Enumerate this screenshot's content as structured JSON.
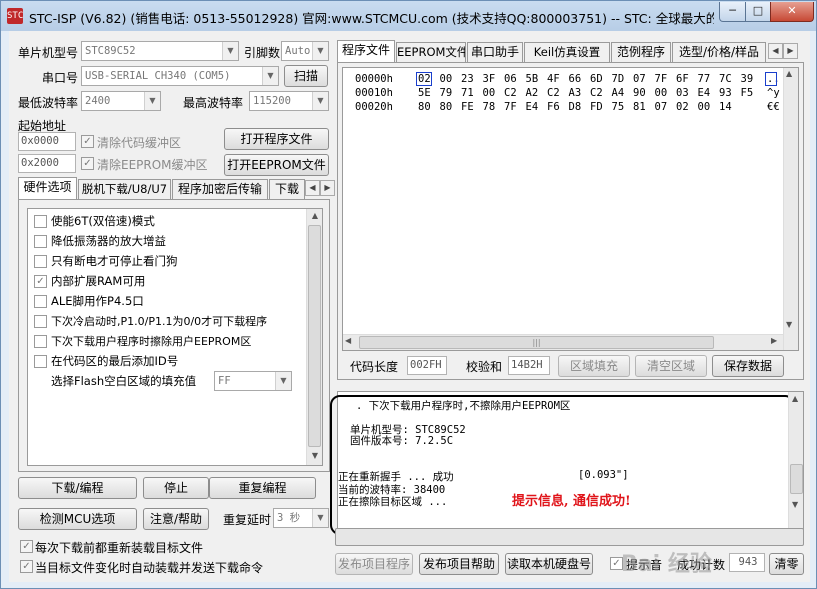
{
  "window": {
    "title": "STC-ISP (V6.82) (销售电话: 0513-55012928) 官网:www.STCMCU.com (技术支持QQ:800003751) -- STC: 全球最大的8051",
    "icon": "STC",
    "min": "─",
    "max": "□",
    "close": "✕"
  },
  "left": {
    "mcu_label": "单片机型号",
    "mcu_value": "STC89C52",
    "pin_label": "引脚数",
    "pin_value": "Auto",
    "port_label": "串口号",
    "port_value": "USB-SERIAL CH340 (COM5)",
    "scan_btn": "扫描",
    "min_baud_label": "最低波特率",
    "min_baud_value": "2400",
    "max_baud_label": "最高波特率",
    "max_baud_value": "115200",
    "start_addr_label": "起始地址",
    "addr_code": "0x0000",
    "addr_eeprom": "0x2000",
    "clear_code_label": "清除代码缓冲区",
    "clear_eeprom_label": "清除EEPROM缓冲区",
    "open_prog_btn": "打开程序文件",
    "open_eeprom_btn": "打开EEPROM文件",
    "tabs": [
      "硬件选项",
      "脱机下载/U8/U7",
      "程序加密后传输",
      "下载"
    ],
    "options": [
      {
        "label": "使能6T(双倍速)模式",
        "checked": false
      },
      {
        "label": "降低振荡器的放大增益",
        "checked": false
      },
      {
        "label": "只有断电才可停止看门狗",
        "checked": false
      },
      {
        "label": "内部扩展RAM可用",
        "checked": true
      },
      {
        "label": "ALE脚用作P4.5口",
        "checked": false
      },
      {
        "label": "下次冷启动时,P1.0/P1.1为0/0才可下载程序",
        "checked": false
      },
      {
        "label": "下次下载用户程序时擦除用户EEPROM区",
        "checked": false
      },
      {
        "label": "在代码区的最后添加ID号",
        "checked": false
      }
    ],
    "fill_label": "选择Flash空白区域的填充值",
    "fill_value": "FF",
    "download_btn": "下载/编程",
    "stop_btn": "停止",
    "reprogram_btn": "重复编程",
    "detect_btn": "检测MCU选项",
    "help_btn": "注意/帮助",
    "delay_label": "重复延时",
    "delay_value": "3 秒",
    "reload_label": "每次下载前都重新装载目标文件",
    "auto_label": "当目标文件变化时自动装载并发送下载命令"
  },
  "right": {
    "tabs": [
      "程序文件",
      "EEPROM文件",
      "串口助手",
      "Keil仿真设置",
      "范例程序",
      "选型/价格/样品"
    ],
    "hex_rows": [
      {
        "addr": "00000h",
        "bytes": [
          "02",
          "00",
          "23",
          "3F",
          "06",
          "5B",
          "4F",
          "66",
          "6D",
          "7D",
          "07",
          "7F",
          "6F",
          "77",
          "7C",
          "39"
        ],
        "ascii": ".."
      },
      {
        "addr": "00010h",
        "bytes": [
          "5E",
          "79",
          "71",
          "00",
          "C2",
          "A2",
          "C2",
          "A3",
          "C2",
          "A4",
          "90",
          "00",
          "03",
          "E4",
          "93",
          "F5"
        ],
        "ascii": "^y"
      },
      {
        "addr": "00020h",
        "bytes": [
          "80",
          "80",
          "FE",
          "78",
          "7F",
          "E4",
          "F6",
          "D8",
          "FD",
          "75",
          "81",
          "07",
          "02",
          "00",
          "14"
        ],
        "ascii": "€€"
      }
    ],
    "code_len_label": "代码长度",
    "code_len_value": "002FH",
    "checksum_label": "校验和",
    "checksum_value": "14B2H",
    "fill_btn": "区域填充",
    "clear_btn": "清空区域",
    "save_btn": "保存数据",
    "log": {
      "line1": "下次下载用户程序时,不擦除用户EEPROM区",
      "line2": "单片机型号: STC89C52",
      "line3": "固件版本号: 7.2.5C",
      "line4": "正在重新握手 ... 成功",
      "line4_time": "[0.093\"]",
      "line5": "当前的波特率: 38400",
      "line6": "正在擦除目标区域 ..."
    },
    "annotation": "提示信息, 通信成功!",
    "publish_prog_btn": "发布项目程序",
    "publish_help_btn": "发布项目帮助",
    "read_disk_btn": "读取本机硬盘号",
    "tip_label": "提示音",
    "success_label": "成功计数",
    "success_value": "943",
    "clear_count_btn": "清零"
  },
  "watermark": "Bai 经验",
  "colors": {
    "annotation": "#e0141a",
    "selection_box": "#1a3fcc",
    "log_border": "#000000"
  }
}
